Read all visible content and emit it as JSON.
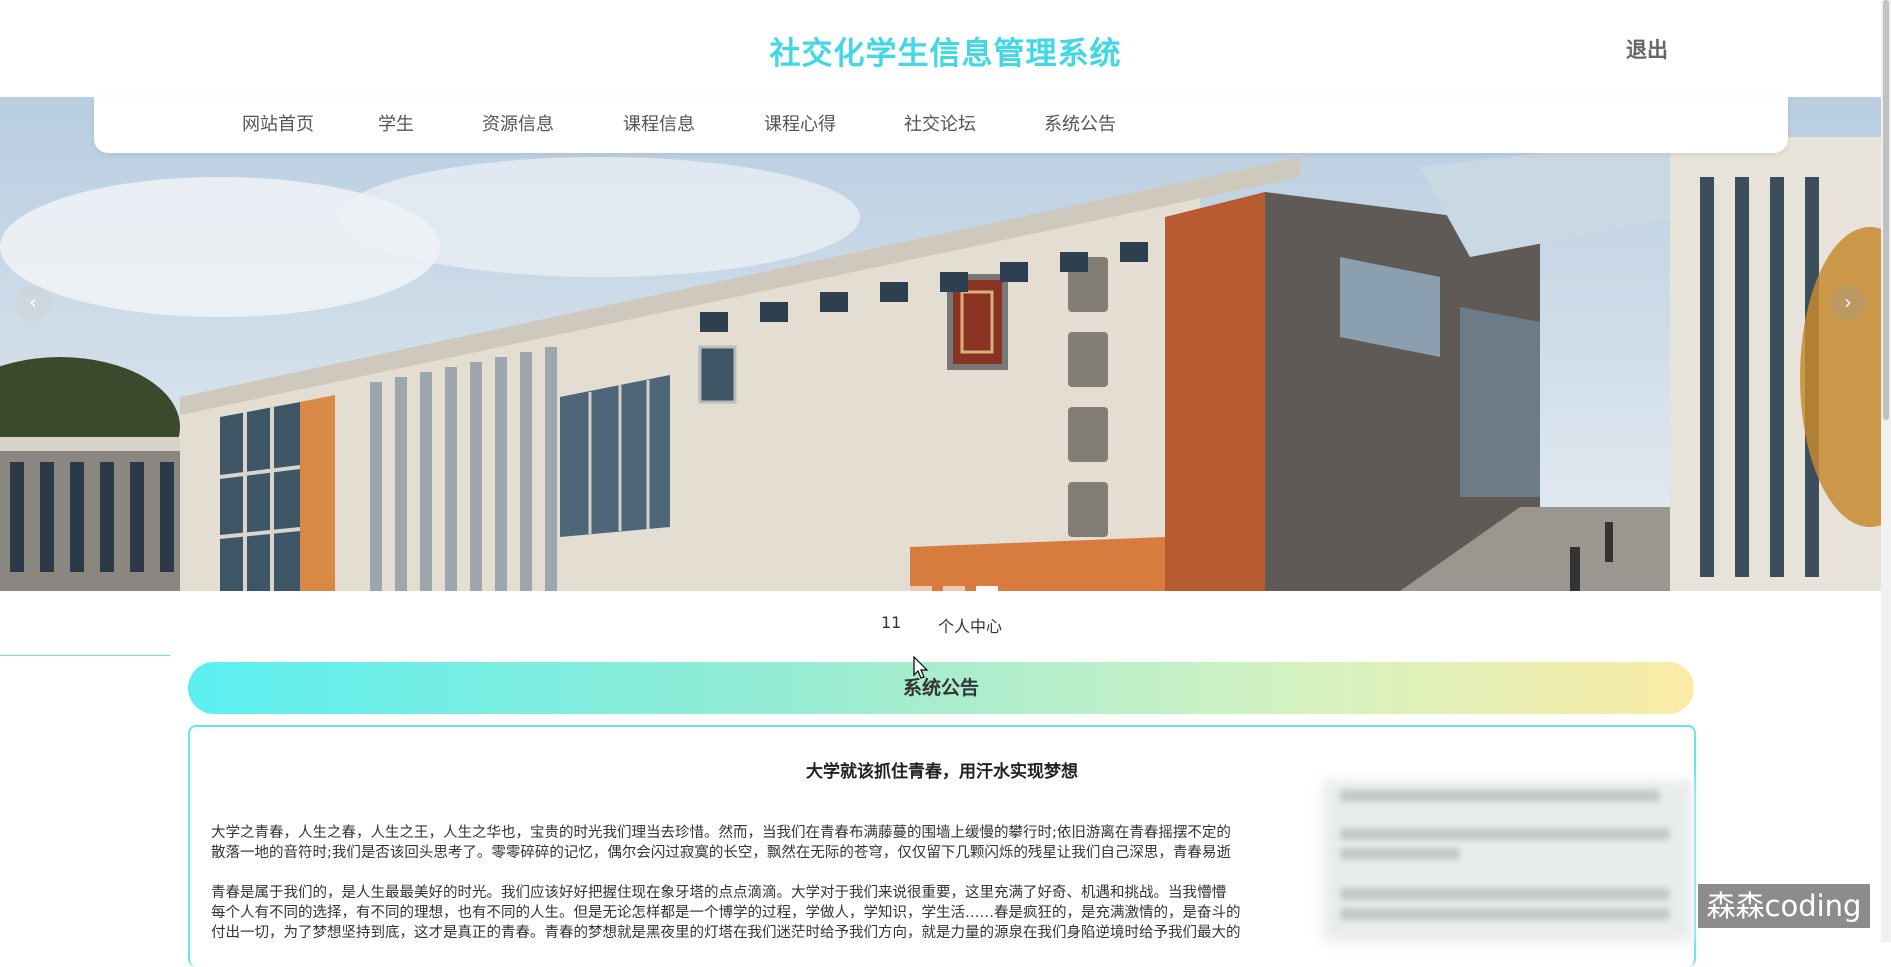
{
  "header": {
    "title": "社交化学生信息管理系统",
    "logout_label": "退出",
    "title_color": "#40d7e6"
  },
  "nav": {
    "items": [
      "网站首页",
      "学生",
      "资源信息",
      "课程信息",
      "课程心得",
      "社交论坛",
      "系统公告"
    ]
  },
  "banner": {
    "prev_icon": "chevron-left-icon",
    "next_icon": "chevron-right-icon",
    "slide_count": 3
  },
  "user_bar": {
    "username": "11",
    "center_label": "个人中心"
  },
  "section": {
    "title": "系统公告"
  },
  "notice": {
    "title": "大学就该抓住青春，用汗水实现梦想",
    "paragraphs": [
      "大学之青春，人生之春，人生之王，人生之华也，宝贵的时光我们理当去珍惜。然而，当我们在青春布满藤蔓的围墙上缓慢的攀行时;依旧游离在青春摇摆不定的",
      "散落一地的音符时;我们是否该回头思考了。零零碎碎的记忆，偶尔会闪过寂寞的长空，飘然在无际的苍穹，仅仅留下几颗闪烁的残星让我们自己深思，青春易逝",
      "青春是属于我们的，是人生最最美好的时光。我们应该好好把握住现在象牙塔的点点滴滴。大学对于我们来说很重要，这里充满了好奇、机遇和挑战。当我懵懵",
      "每个人有不同的选择，有不同的理想，也有不同的人生。但是无论怎样都是一个博学的过程，学做人，学知识，学生活……春是疯狂的，是充满激情的，是奋斗的",
      "付出一切，为了梦想坚持到底，这才是真正的青春。青春的梦想就是黑夜里的灯塔在我们迷茫时给予我们方向，就是力量的源泉在我们身陷逆境时给予我们最大的"
    ]
  },
  "watermark": "森森coding"
}
